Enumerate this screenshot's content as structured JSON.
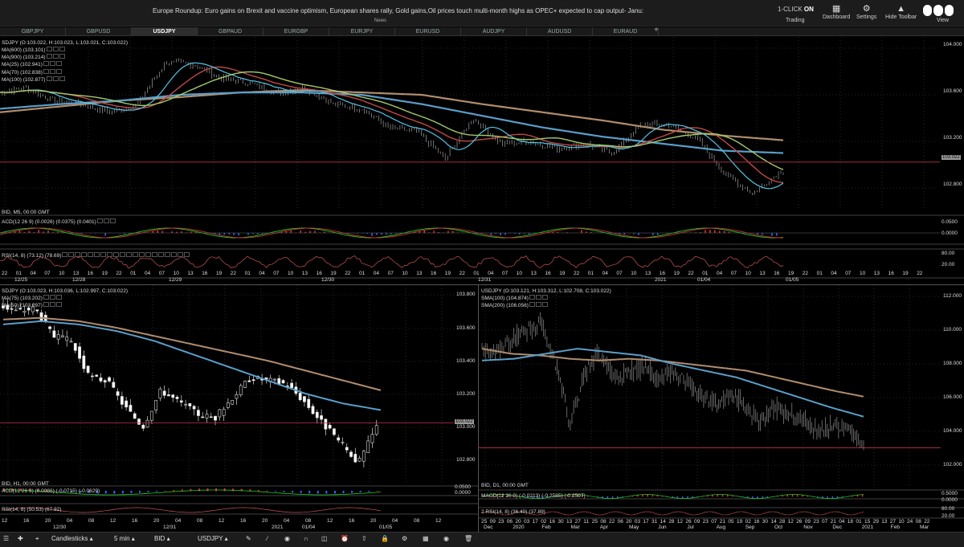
{
  "news": {
    "headline": "Europe Roundup: Euro gains  on Brexit and vaccine optimism, European shares rally, Gold gains,Oil prices touch multi-month highs as OPEC+ expected to cap output- Janu:",
    "label": "News"
  },
  "toolbar": {
    "one_click_prefix": "1-CLICK",
    "one_click_state": "ON",
    "trading": "Trading",
    "dashboard": "Dashboard",
    "settings": "Settings",
    "hide_toolbar": "Hide Toolbar",
    "view": "View"
  },
  "tabs": [
    "GBPJPY",
    "GBPUSD",
    "USDJPY",
    "GBPAUD",
    "EURGBP",
    "EURJPY",
    "EURUSD",
    "AUDJPY",
    "AUDUSD",
    "EURAUD"
  ],
  "active_tab": "USDJPY",
  "top_chart": {
    "legend": [
      "SDJPY (O:103.022, H:103.023, L:103.021, C:103.022)",
      "MA(600) (103.101)",
      "MA(900) (103.214)",
      "MA(25) (102.941)",
      "MA(70) (102.838)",
      "MA(100) (102.877)"
    ],
    "footer": "BID, M5, 00:00 GMT",
    "macd": "ACD(12 26 9) (0.0026) (0.0375) (0.0401)",
    "rsi": "RSI(14, 8) (73.12) (78.69)",
    "price_ticks": [
      "104.000",
      "103.600",
      "103.200",
      "102.800"
    ],
    "price_tag": "103.022",
    "macd_ticks": [
      "0.0500",
      "0.0000"
    ],
    "rsi_ticks": [
      "80.00",
      "20.00"
    ],
    "time_ticks": [
      "22",
      "01",
      "04",
      "07",
      "10",
      "13",
      "16",
      "19",
      "22",
      "01",
      "04",
      "07",
      "10",
      "13",
      "16",
      "19",
      "22",
      "01",
      "04",
      "07",
      "10",
      "13",
      "16",
      "19",
      "22",
      "01",
      "04",
      "07",
      "10",
      "13",
      "16",
      "19",
      "22",
      "01",
      "04",
      "07",
      "10",
      "13",
      "16",
      "19",
      "22",
      "01",
      "04",
      "07",
      "10",
      "13",
      "16",
      "19",
      "22",
      "01",
      "04",
      "07",
      "10",
      "13",
      "16",
      "19",
      "22",
      "01",
      "04",
      "07",
      "10",
      "13",
      "16",
      "19",
      "22"
    ],
    "date_ticks": [
      "12/25",
      "12/28",
      "12/29",
      "12/30",
      "12/31",
      "2021",
      "01/04",
      "01/05"
    ]
  },
  "bottom_left_chart": {
    "legend": [
      "SDJPY (O:103.023, H:103.036, L:102.997, C:103.022)",
      "MA(75) (103.202)",
      "MA(50) (103.097)"
    ],
    "footer": "BID, H1, 00:00 GMT",
    "macd": "ACD(12 26 9) (0.0086) (-0.0715) (-0.0629)",
    "rsi": "RSI(14, 8) (50.53) (67.92)",
    "price_ticks": [
      "103.800",
      "103.600",
      "103.400",
      "103.200",
      "103.000",
      "102.800"
    ],
    "price_tag": "103.022",
    "macd_ticks": [
      "0.0500",
      "0.0000"
    ],
    "time_ticks": [
      "12",
      "16",
      "20",
      "04",
      "08",
      "12",
      "16",
      "20",
      "04",
      "08",
      "12",
      "16",
      "20",
      "04",
      "08",
      "12",
      "16",
      "20",
      "04",
      "08",
      "12"
    ],
    "date_ticks": [
      "12/30",
      "12/31",
      "2021",
      "01/04",
      "01/05"
    ]
  },
  "bottom_right_chart": {
    "legend": [
      "USDJPY (O:103.121, H:103.312, L:102.708, C:103.022)",
      "SMA(100) (104.874)",
      "SMA(200) (106.056)"
    ],
    "footer": "BID, D1, 00:00 GMT",
    "macd": "MACD(12 26 9) (-0.0213) (-0.2585) (-0.2597)",
    "rsi": "2 RSI(14, 8) (36.40) (37.89)",
    "price_ticks": [
      "112.000",
      "110.000",
      "108.000",
      "106.000",
      "104.000",
      "102.000"
    ],
    "macd_ticks": [
      "0.5000",
      "0.0000"
    ],
    "rsi_ticks": [
      "80.00",
      "20.00"
    ],
    "time_ticks": [
      "25",
      "09",
      "23",
      "06",
      "20",
      "03",
      "17",
      "02",
      "16",
      "30",
      "13",
      "27",
      "11",
      "25",
      "08",
      "22",
      "06",
      "20",
      "03",
      "17",
      "31",
      "14",
      "28",
      "12",
      "26",
      "09",
      "23",
      "07",
      "21",
      "05",
      "19",
      "02",
      "16",
      "30",
      "14",
      "28",
      "12",
      "26",
      "09",
      "23",
      "07",
      "21",
      "04",
      "18",
      "01",
      "15",
      "29",
      "13",
      "27",
      "10",
      "24",
      "08",
      "22"
    ],
    "month_ticks": [
      "Dec",
      "2020",
      "Feb",
      "Mar",
      "Apr",
      "May",
      "Jun",
      "Jul",
      "Aug",
      "Sep",
      "Oct",
      "Nov",
      "Dec",
      "2021",
      "Feb",
      "Mar"
    ]
  },
  "bottom_bar": {
    "chart_type": "Candlesticks",
    "timeframe": "5 min",
    "price_side": "BID",
    "symbol": "USDJPY"
  },
  "colors": {
    "ma_slow": "#b08d6e",
    "ma_mid": "#5a9ec9",
    "ma_fast": "#a3c96b",
    "ma_red": "#c04848",
    "ma_light": "#53c6e8",
    "price_line": "#c0304a"
  }
}
